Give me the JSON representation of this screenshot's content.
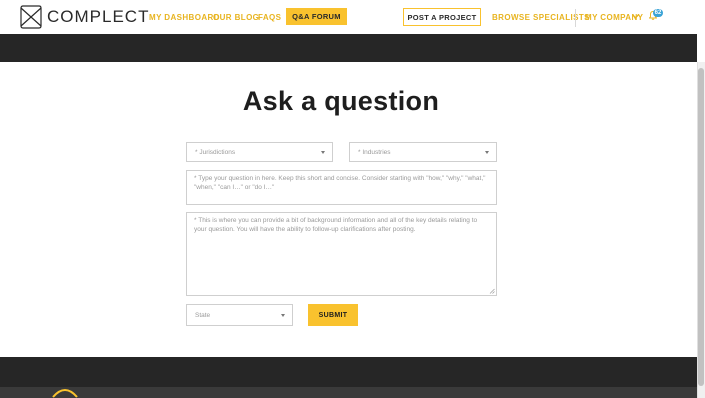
{
  "header": {
    "logo_text": "COMPLECT",
    "nav": [
      "MY DASHBOARD",
      "OUR BLOG",
      "FAQS"
    ],
    "forum_button": "Q&A FORUM",
    "post_project_button": "POST A PROJECT",
    "browse_specialists": "BROWSE SPECIALISTS",
    "my_company": "MY COMPANY",
    "notification_count": "62"
  },
  "main": {
    "title": "Ask a question",
    "jurisdictions": "* Jurisdictions",
    "industries": "* Industries",
    "question_placeholder": "*  Type your question in here. Keep this short and concise. Consider starting with \"how,\" \"why,\" \"what,\" \"when,\" \"can I…\" or \"do I…\"",
    "details_placeholder": "*  This is where you can provide a bit of background information and all of the key details relating to your question. You will have the ability to follow-up clarifications after posting.",
    "state": "State",
    "submit": "SUBMIT"
  },
  "colors": {
    "accent": "#f9c22e",
    "nav_text": "#e8b420",
    "dark_band": "#262626"
  }
}
